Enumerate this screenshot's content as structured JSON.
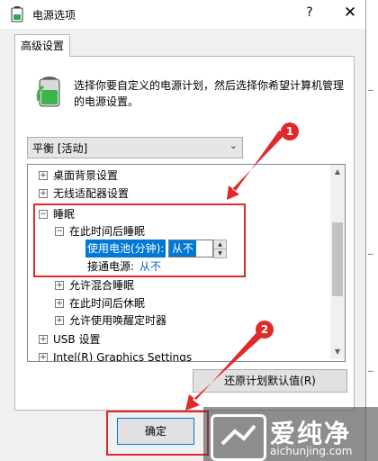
{
  "window": {
    "title": "电源选项",
    "help_glyph": "?",
    "close_glyph": "✕"
  },
  "tab": {
    "label": "高级设置"
  },
  "description": "选择你要自定义的电源计划，然后选择你希望计算机管理的电源设置。",
  "plan_select": {
    "value": "平衡 [活动]"
  },
  "tree": {
    "desktop_background": "桌面背景设置",
    "wireless_adapter": "无线适配器设置",
    "sleep": "睡眠",
    "sleep_after": "在此时间后睡眠",
    "on_battery_label": "使用电池(分钟):",
    "on_battery_value": "从不",
    "plugged_in_label": "接通电源:",
    "plugged_in_value": "从不",
    "hybrid_sleep": "允许混合睡眠",
    "hibernate_after": "在此时间后休眠",
    "wake_timers": "允许使用唤醒定时器",
    "usb": "USB 设置",
    "graphics": "Intel(R) Graphics Settings"
  },
  "buttons": {
    "restore": "还原计划默认值(R)",
    "ok": "确定"
  },
  "annotations": {
    "badge1": "1",
    "badge2": "2"
  },
  "watermark": {
    "name": "爱纯净",
    "url": "aichunjing.com"
  },
  "colors": {
    "accent": "#0078d7",
    "annotation_red": "#e02a2a"
  }
}
